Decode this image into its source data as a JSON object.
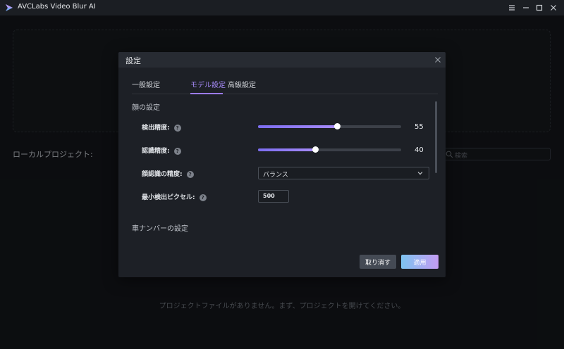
{
  "app": {
    "title": "AVCLabs Video Blur AI",
    "icons": [
      "app-logo-icon",
      "menu-icon",
      "minimize-icon",
      "maximize-icon",
      "close-icon"
    ],
    "local_projects_label": "ローカルプロジェクト:",
    "search_placeholder": "検索",
    "empty_message": "プロジェクトファイルがありません。まず、プロジェクトを開けてください。"
  },
  "dialog": {
    "title": "設定",
    "tabs": [
      {
        "label": "一般設定",
        "active": false
      },
      {
        "label": "モデル設定",
        "active": true
      },
      {
        "label": "高級設定",
        "active": false
      }
    ],
    "face_section_title": "顔の設定",
    "detection_accuracy": {
      "label": "検出精度:",
      "value": "55",
      "fraction": 0.55
    },
    "recognition_accuracy": {
      "label": "認識精度:",
      "value": "40",
      "fraction": 0.4
    },
    "face_recognition_precision": {
      "label": "顔認識の精度:",
      "selected": "バランス"
    },
    "min_detect_pixels": {
      "label": "最小検出ピクセル:",
      "value": "500"
    },
    "plate_section_title": "車ナンバーの設定",
    "help_glyph": "?",
    "cancel_label": "取り消す",
    "apply_label": "適用"
  },
  "colors": {
    "background": "#131519",
    "dialog": "#1d2026",
    "accent": "#9b7bf0",
    "apply_gradient_start": "#7dc3f0",
    "apply_gradient_end": "#c49cf2"
  }
}
